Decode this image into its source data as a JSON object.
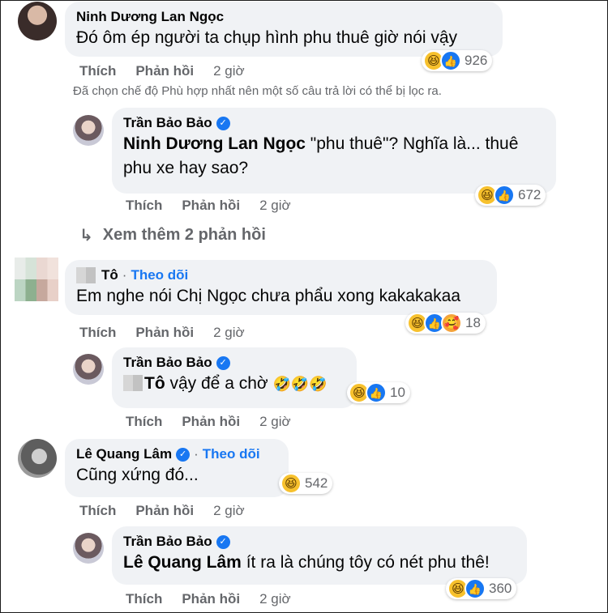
{
  "comments": [
    {
      "author": "Ninh Dương Lan Ngọc",
      "text": "Đó ôm ép người ta chụp hình phu thuê giờ nói vậy",
      "reaction_count": "926",
      "actions": {
        "like": "Thích",
        "reply": "Phản hồi",
        "time": "2 giờ"
      }
    },
    {
      "author": "Trần Bảo Bảo",
      "mention": "Ninh Dương Lan Ngọc",
      "text": " \"phu thuê\"? Nghĩa là... thuê phu xe hay sao?",
      "reaction_count": "672",
      "actions": {
        "like": "Thích",
        "reply": "Phản hồi",
        "time": "2 giờ"
      }
    },
    {
      "author": "Tô",
      "follow": "Theo dõi",
      "text": "Em nghe nói Chị Ngọc chưa phẩu xong kakakakaa",
      "reaction_count": "18",
      "actions": {
        "like": "Thích",
        "reply": "Phản hồi",
        "time": "2 giờ"
      }
    },
    {
      "author": "Trần Bảo Bảo",
      "mention": "Tô",
      "text": " vậy để a chờ",
      "emojis": "🤣🤣🤣",
      "reaction_count": "10",
      "actions": {
        "like": "Thích",
        "reply": "Phản hồi",
        "time": "2 giờ"
      }
    },
    {
      "author": "Lê Quang Lâm",
      "follow": "Theo dõi",
      "text": "Cũng xứng đó...",
      "reaction_count": "542",
      "actions": {
        "like": "Thích",
        "reply": "Phản hồi",
        "time": "2 giờ"
      }
    },
    {
      "author": "Trần Bảo Bảo",
      "mention": "Lê Quang Lâm",
      "text": " ít ra là chúng tôy có nét phu thê!",
      "reaction_count": "360",
      "actions": {
        "like": "Thích",
        "reply": "Phản hồi",
        "time": "2 giờ"
      }
    }
  ],
  "filter_note": "Đã chọn chế độ Phù hợp nhất nên một số câu trả lời có thể bị lọc ra.",
  "more_replies": {
    "icon": "reply-arrow-icon",
    "label": "Xem thêm 2 phản hồi"
  },
  "colors": {
    "bubble": "#f0f2f5",
    "secondary_text": "#65676b",
    "link": "#1877f2"
  }
}
